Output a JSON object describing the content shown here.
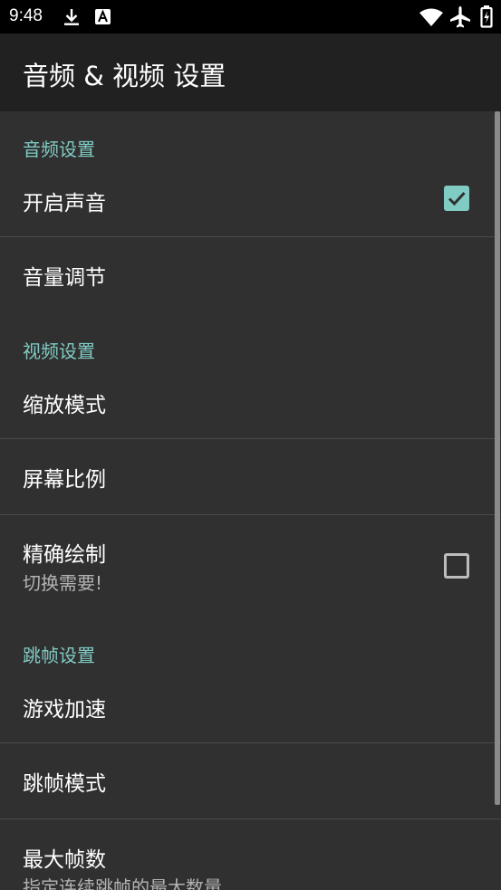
{
  "status_bar": {
    "time": "9:48",
    "icons": [
      "download-icon",
      "a-notification-icon",
      "wifi-icon",
      "airplane-icon",
      "battery-icon"
    ]
  },
  "toolbar": {
    "title": "音频 & 视频 设置"
  },
  "colors": {
    "accent": "#80cbc4",
    "background": "#303030",
    "toolbar": "#212121",
    "statusbar": "#000000"
  },
  "categories": {
    "audio": "音频设置",
    "video": "视频设置",
    "frameskip": "跳帧设置"
  },
  "prefs": {
    "enable_sound": {
      "title": "开启声音",
      "checked": true
    },
    "volume": {
      "title": "音量调节"
    },
    "scale_mode": {
      "title": "缩放模式"
    },
    "aspect_ratio": {
      "title": "屏幕比例"
    },
    "precise_draw": {
      "title": "精确绘制",
      "summary": "切换需要!",
      "checked": false
    },
    "game_speedup": {
      "title": "游戏加速"
    },
    "frameskip_mode": {
      "title": "跳帧模式"
    },
    "max_frames": {
      "title": "最大帧数",
      "summary": "指定连续跳帧的最大数量"
    }
  }
}
